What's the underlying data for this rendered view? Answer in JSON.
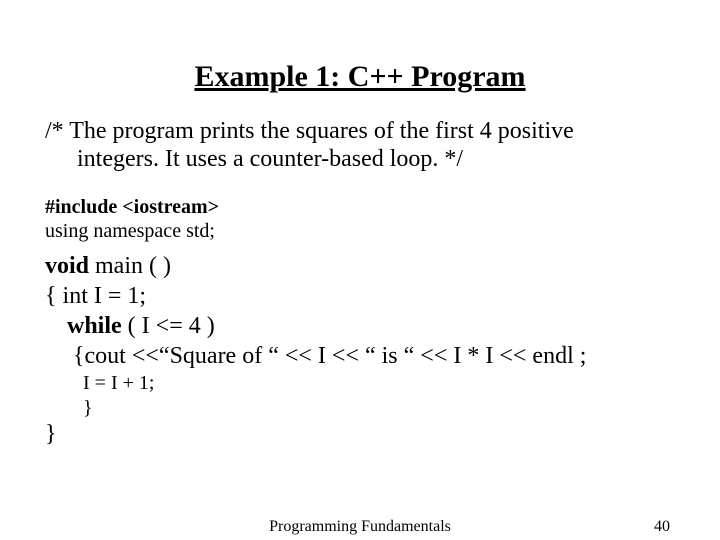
{
  "title": "Example 1: C++ Program",
  "comment_l1": "/* The program prints the squares of the first 4 positive",
  "comment_l2": "integers. It uses a counter-based loop. */",
  "include_line": "#include <iostream>",
  "using_line": "using namespace std;",
  "code_l1_a": "void",
  "code_l1_b": " main ( )",
  "code_l2": "{ int I = 1;",
  "code_l3_a": "while",
  "code_l3_b": " ( I <= 4 )",
  "code_l4": "{cout <<“Square of  “ << I << “ is “ << I * I << endl ;",
  "code_l5": "I = I + 1;",
  "code_l6": "}",
  "code_l7": "}",
  "footer_center": "Programming Fundamentals",
  "footer_page": "40"
}
